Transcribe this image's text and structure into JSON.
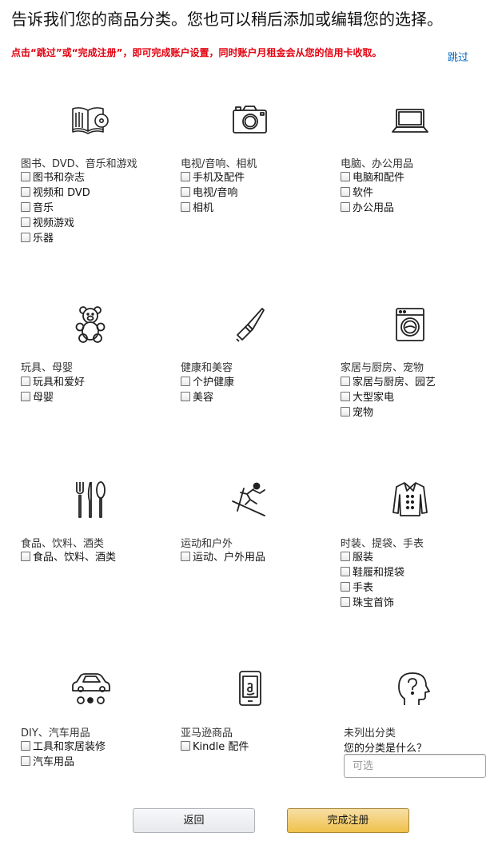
{
  "header": {
    "title": "告诉我们您的商品分类。您也可以稍后添加或编辑您的选择。",
    "notice": "点击“跳过”或“完成注册”，即可完成账户设置，同时账户月租金会从您的信用卡收取。",
    "skip_label": "跳过"
  },
  "categories": [
    {
      "title": "图书、DVD、音乐和游戏",
      "icon": "book-cd-icon",
      "options": [
        "图书和杂志",
        "视频和 DVD",
        "音乐",
        "视频游戏",
        "乐器"
      ]
    },
    {
      "title": "电视/音响、相机",
      "icon": "camera-icon",
      "options": [
        "手机及配件",
        "电视/音响",
        "相机"
      ]
    },
    {
      "title": "电脑、办公用品",
      "icon": "laptop-icon",
      "options": [
        "电脑和配件",
        "软件",
        "办公用品"
      ]
    },
    {
      "title": "玩具、母婴",
      "icon": "teddy-bear-icon",
      "options": [
        "玩具和爱好",
        "母婴"
      ]
    },
    {
      "title": "健康和美容",
      "icon": "lipstick-icon",
      "options": [
        "个护健康",
        "美容"
      ]
    },
    {
      "title": "家居与厨房、宠物",
      "icon": "washing-machine-icon",
      "options": [
        "家居与厨房、园艺",
        "大型家电",
        "宠物"
      ]
    },
    {
      "title": "食品、饮料、酒类",
      "icon": "cutlery-icon",
      "options": [
        "食品、饮料、酒类"
      ]
    },
    {
      "title": "运动和户外",
      "icon": "skier-icon",
      "options": [
        "运动、户外用品"
      ]
    },
    {
      "title": "时装、提袋、手表",
      "icon": "jacket-icon",
      "options": [
        "服装",
        "鞋履和提袋",
        "手表",
        "珠宝首饰"
      ]
    },
    {
      "title": "DIY、汽车用品",
      "icon": "car-icon",
      "options": [
        "工具和家居装修",
        "汽车用品"
      ]
    },
    {
      "title": "亚马逊商品",
      "icon": "kindle-icon",
      "options": [
        "Kindle 配件"
      ]
    },
    {
      "title": "未列出分类",
      "icon": "question-head-icon",
      "options": []
    }
  ],
  "other": {
    "question": "您的分类是什么？",
    "placeholder": "可选"
  },
  "buttons": {
    "back_label": "返回",
    "done_label": "完成注册"
  }
}
